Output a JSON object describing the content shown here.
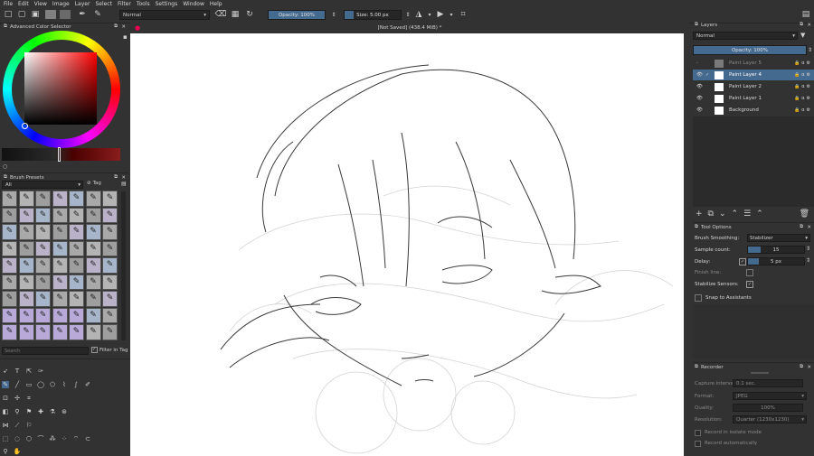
{
  "menu": [
    "File",
    "Edit",
    "View",
    "Image",
    "Layer",
    "Select",
    "Filter",
    "Tools",
    "Settings",
    "Window",
    "Help"
  ],
  "toolbar": {
    "blend_mode": "Normal",
    "opacity_label": "Opacity: 100%",
    "size_label": "Size: 5.00 px"
  },
  "canvas_tab": "[Not Saved]  (438.4 MiB) *",
  "color_selector": {
    "title": "Advanced Color Selector",
    "hue_color": "#ff0000"
  },
  "brush_presets": {
    "title": "Brush Presets",
    "filter_all": "All",
    "tag_label": "Tag",
    "search_placeholder": "Search",
    "filter_in_tag": "Filter in Tag"
  },
  "layers": {
    "title": "Layers",
    "blend_mode": "Normal",
    "opacity_label": "Opacity:  100%",
    "items": [
      {
        "name": "Paint Layer 5",
        "visible": false,
        "selected": false
      },
      {
        "name": "Paint Layer 4",
        "visible": true,
        "selected": true
      },
      {
        "name": "Paint Layer 2",
        "visible": true,
        "selected": false
      },
      {
        "name": "Paint Layer 1",
        "visible": true,
        "selected": false
      },
      {
        "name": "Background",
        "visible": true,
        "selected": false
      }
    ]
  },
  "tool_options": {
    "title": "Tool Options",
    "brush_smoothing_label": "Brush Smoothing:",
    "brush_smoothing_value": "Stabilizer",
    "sample_count_label": "Sample count:",
    "sample_count_value": "15",
    "delay_label": "Delay:",
    "delay_value": "5 px",
    "finish_line_label": "Finish line:",
    "stabilize_sensors_label": "Stabilize Sensors:",
    "snap_label": "Snap to Assistants"
  },
  "recorder": {
    "title": "Recorder",
    "capture_interval_label": "Capture interval:",
    "capture_interval_value": "0.1 sec.",
    "format_label": "Format:",
    "format_value": "JPEG",
    "quality_label": "Quality:",
    "quality_value": "100%",
    "resolution_label": "Resolution:",
    "resolution_value": "Quarter (1230x1230)",
    "isolate_label": "Record in isolate mode",
    "auto_label": "Record automatically"
  }
}
